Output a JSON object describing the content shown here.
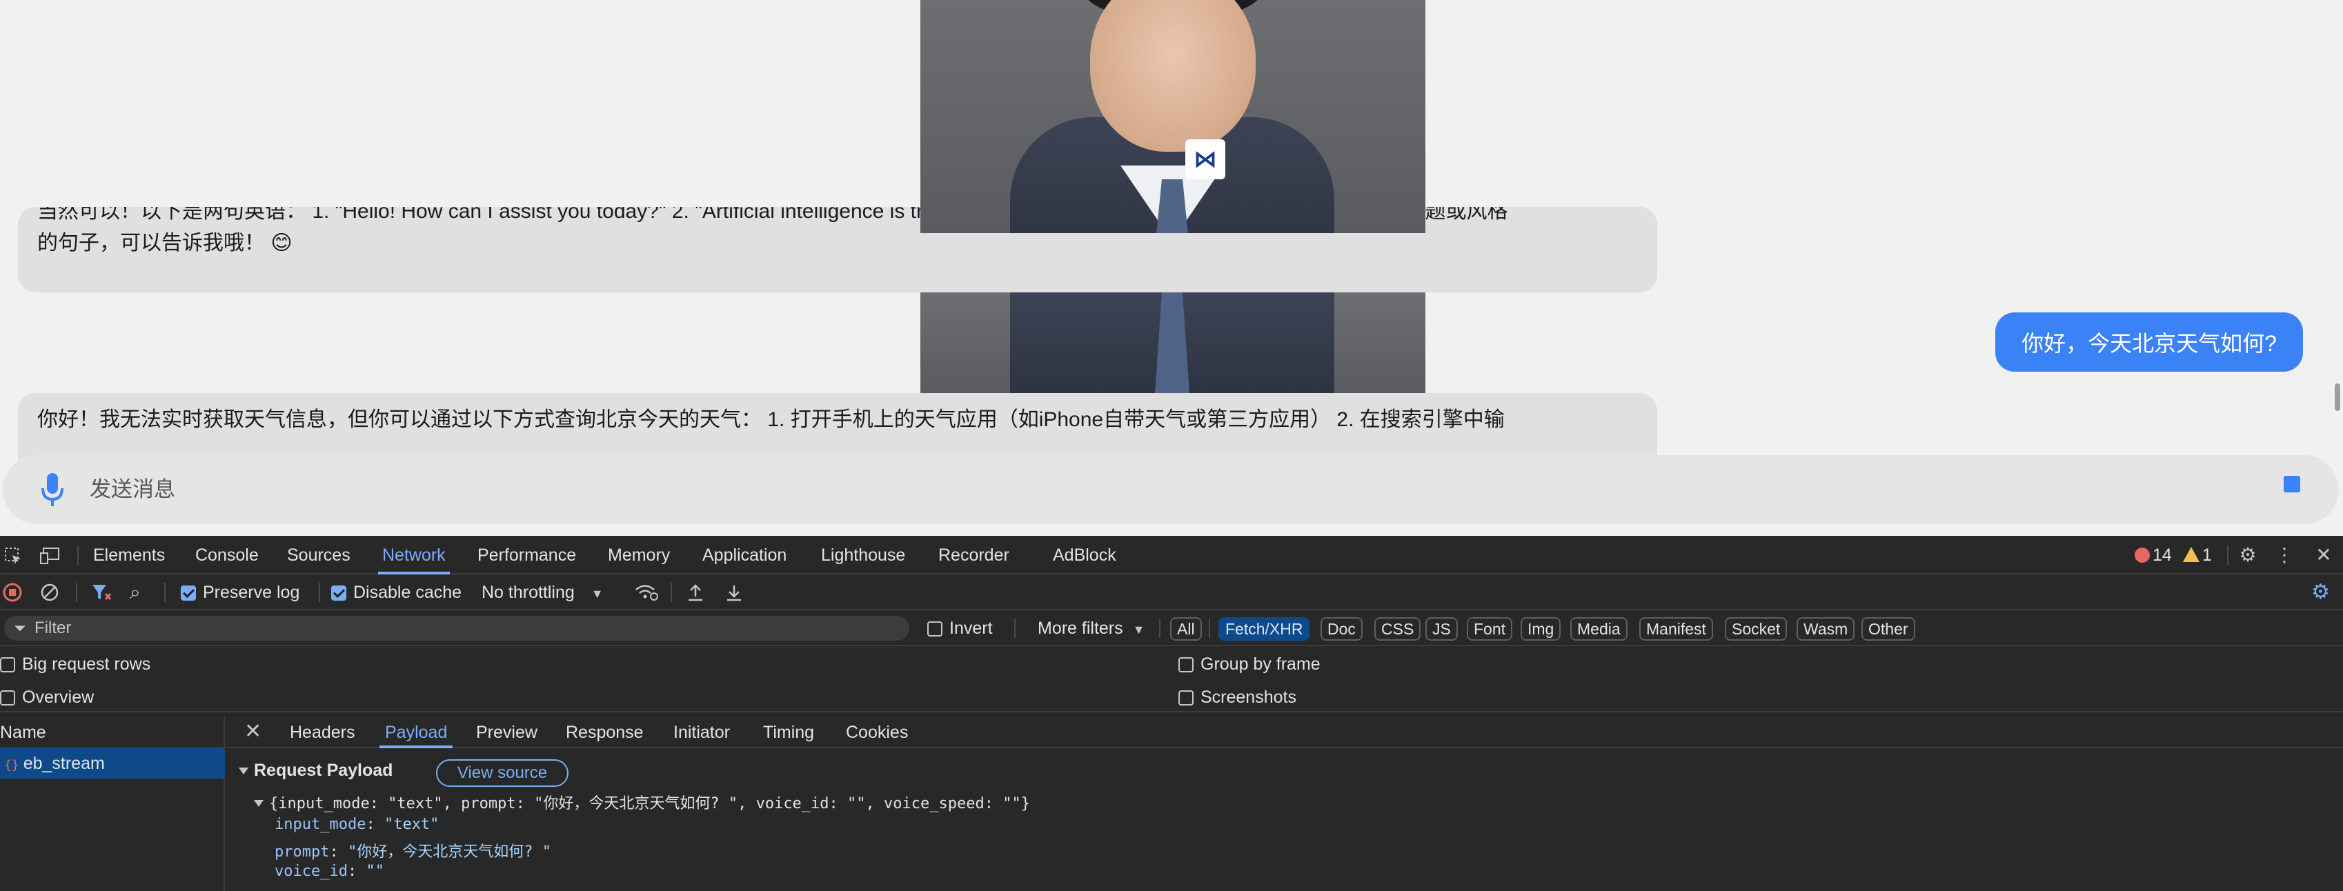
{
  "chat": {
    "ai_message_1_line1": "当然可以！以下是两句英语： 1. \"Hello! How can I assist you today?\" 2. \"Artificial intelligence is transforming the way we live and work.\" 如果需要特定主题或风格",
    "ai_message_1_line2": "的句子，可以告诉我哦！ 😊",
    "user_message": "你好，今天北京天气如何?",
    "ai_message_2": "你好！我无法实时获取天气信息，但你可以通过以下方式查询北京今天的天气： 1. 打开手机上的天气应用（如iPhone自带天气或第三方应用） 2. 在搜索引擎中输",
    "input_placeholder": "发送消息"
  },
  "devtools": {
    "tabs": [
      "Elements",
      "Console",
      "Sources",
      "Network",
      "Performance",
      "Memory",
      "Application",
      "Lighthouse",
      "Recorder",
      "AdBlock"
    ],
    "active_tab": "Network",
    "error_count": "14",
    "warning_count": "1",
    "toolbar": {
      "preserve_log": "Preserve log",
      "disable_cache": "Disable cache",
      "throttling": "No throttling"
    },
    "filter": {
      "placeholder": "Filter",
      "invert": "Invert",
      "more_filters": "More filters",
      "types": [
        "All",
        "Fetch/XHR",
        "Doc",
        "CSS",
        "JS",
        "Font",
        "Img",
        "Media",
        "Manifest",
        "Socket",
        "Wasm",
        "Other"
      ],
      "active_type": "Fetch/XHR"
    },
    "options": {
      "big_request_rows": "Big request rows",
      "overview": "Overview",
      "group_by_frame": "Group by frame",
      "screenshots": "Screenshots"
    },
    "requests": {
      "name_header": "Name",
      "rows": [
        "eb_stream"
      ]
    },
    "detail": {
      "tabs": [
        "Headers",
        "Payload",
        "Preview",
        "Response",
        "Initiator",
        "Timing",
        "Cookies"
      ],
      "active_tab": "Payload",
      "section_title": "Request Payload",
      "view_source": "View source",
      "summary": "{input_mode: \"text\", prompt: \"你好，今天北京天气如何? \", voice_id: \"\", voice_speed: \"\"}",
      "fields": [
        {
          "key": "input_mode",
          "value": "\"text\""
        },
        {
          "key": "prompt",
          "value": "\"你好，今天北京天气如何? \""
        },
        {
          "key": "voice_id",
          "value": "\"\""
        }
      ]
    }
  },
  "icons": [
    "mic-icon",
    "stop-icon",
    "inspect-icon",
    "device-toggle-icon",
    "record-stop-icon",
    "clear-icon",
    "filter-icon",
    "search-icon",
    "network-conditions-icon",
    "upload-icon",
    "download-icon",
    "settings-icon",
    "more-icon",
    "close-icon"
  ],
  "colors": {
    "accent": "#3b82f6",
    "devtools_bg": "#282828",
    "devtools_accent": "#7cacf8",
    "selected_row": "#0e4a8a"
  }
}
